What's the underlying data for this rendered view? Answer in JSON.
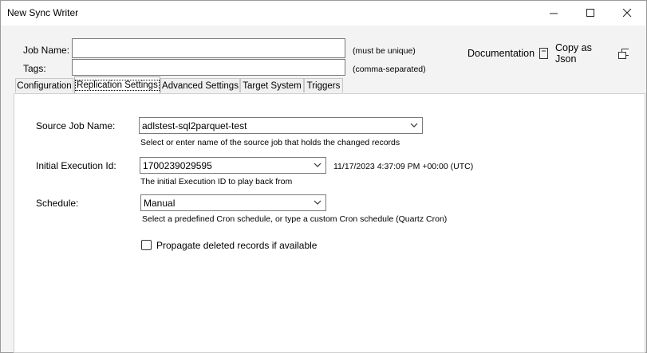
{
  "window": {
    "title": "New Sync Writer"
  },
  "header": {
    "job_name_label": "Job Name:",
    "job_name_value": "",
    "job_name_hint": "(must be unique)",
    "tags_label": "Tags:",
    "tags_value": "",
    "tags_hint": "(comma-separated)",
    "documentation_label": "Documentation",
    "copy_json_label": "Copy as Json"
  },
  "tabs": [
    {
      "label": "Configuration"
    },
    {
      "label": "Replication Settings"
    },
    {
      "label": "Advanced Settings"
    },
    {
      "label": "Target System"
    },
    {
      "label": "Triggers"
    }
  ],
  "form": {
    "source_job": {
      "label": "Source Job Name:",
      "value": "adlstest-sql2parquet-test",
      "help": "Select or enter name of the source job that holds the changed records"
    },
    "initial_exec": {
      "label": "Initial Execution Id:",
      "value": "1700239029595",
      "timestamp": "11/17/2023 4:37:09 PM +00:00 (UTC)",
      "help": "The initial Execution ID to play back from"
    },
    "schedule": {
      "label": "Schedule:",
      "value": "Manual",
      "help": "Select a predefined Cron schedule, or type a custom Cron schedule (Quartz Cron)"
    },
    "propagate_deletes": {
      "label": "Propagate deleted records if available",
      "checked": false
    }
  }
}
